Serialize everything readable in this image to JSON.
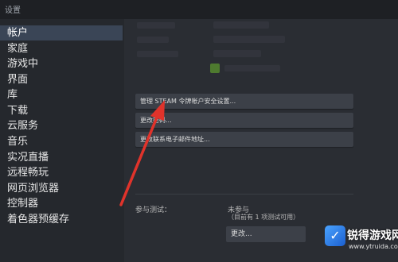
{
  "window": {
    "title": "设置"
  },
  "sidebar": {
    "items": [
      {
        "label": "帐户",
        "active": true
      },
      {
        "label": "家庭"
      },
      {
        "label": "游戏中"
      },
      {
        "label": "界面"
      },
      {
        "label": "库"
      },
      {
        "label": "下载"
      },
      {
        "label": "云服务"
      },
      {
        "label": "音乐"
      },
      {
        "label": "实况直播"
      },
      {
        "label": "远程畅玩"
      },
      {
        "label": "网页浏览器"
      },
      {
        "label": "控制器"
      },
      {
        "label": "着色器预缓存"
      }
    ]
  },
  "account": {
    "buttons": [
      {
        "label": "管理 STEAM 令牌帐户安全设置..."
      },
      {
        "label": "更改密码..."
      },
      {
        "label": "更改联系电子邮件地址..."
      }
    ]
  },
  "beta": {
    "label": "参与测试：",
    "status": "未参与",
    "status_detail": "（目前有 1 项测试可用）",
    "change_button": "更改..."
  },
  "watermark": {
    "title": "锐得游戏网",
    "url": "www.ytruida.com"
  },
  "colors": {
    "background": "#2a2d33",
    "sidebar": "#25282d",
    "active_item": "#3a4556",
    "arrow": "#e0332b"
  }
}
